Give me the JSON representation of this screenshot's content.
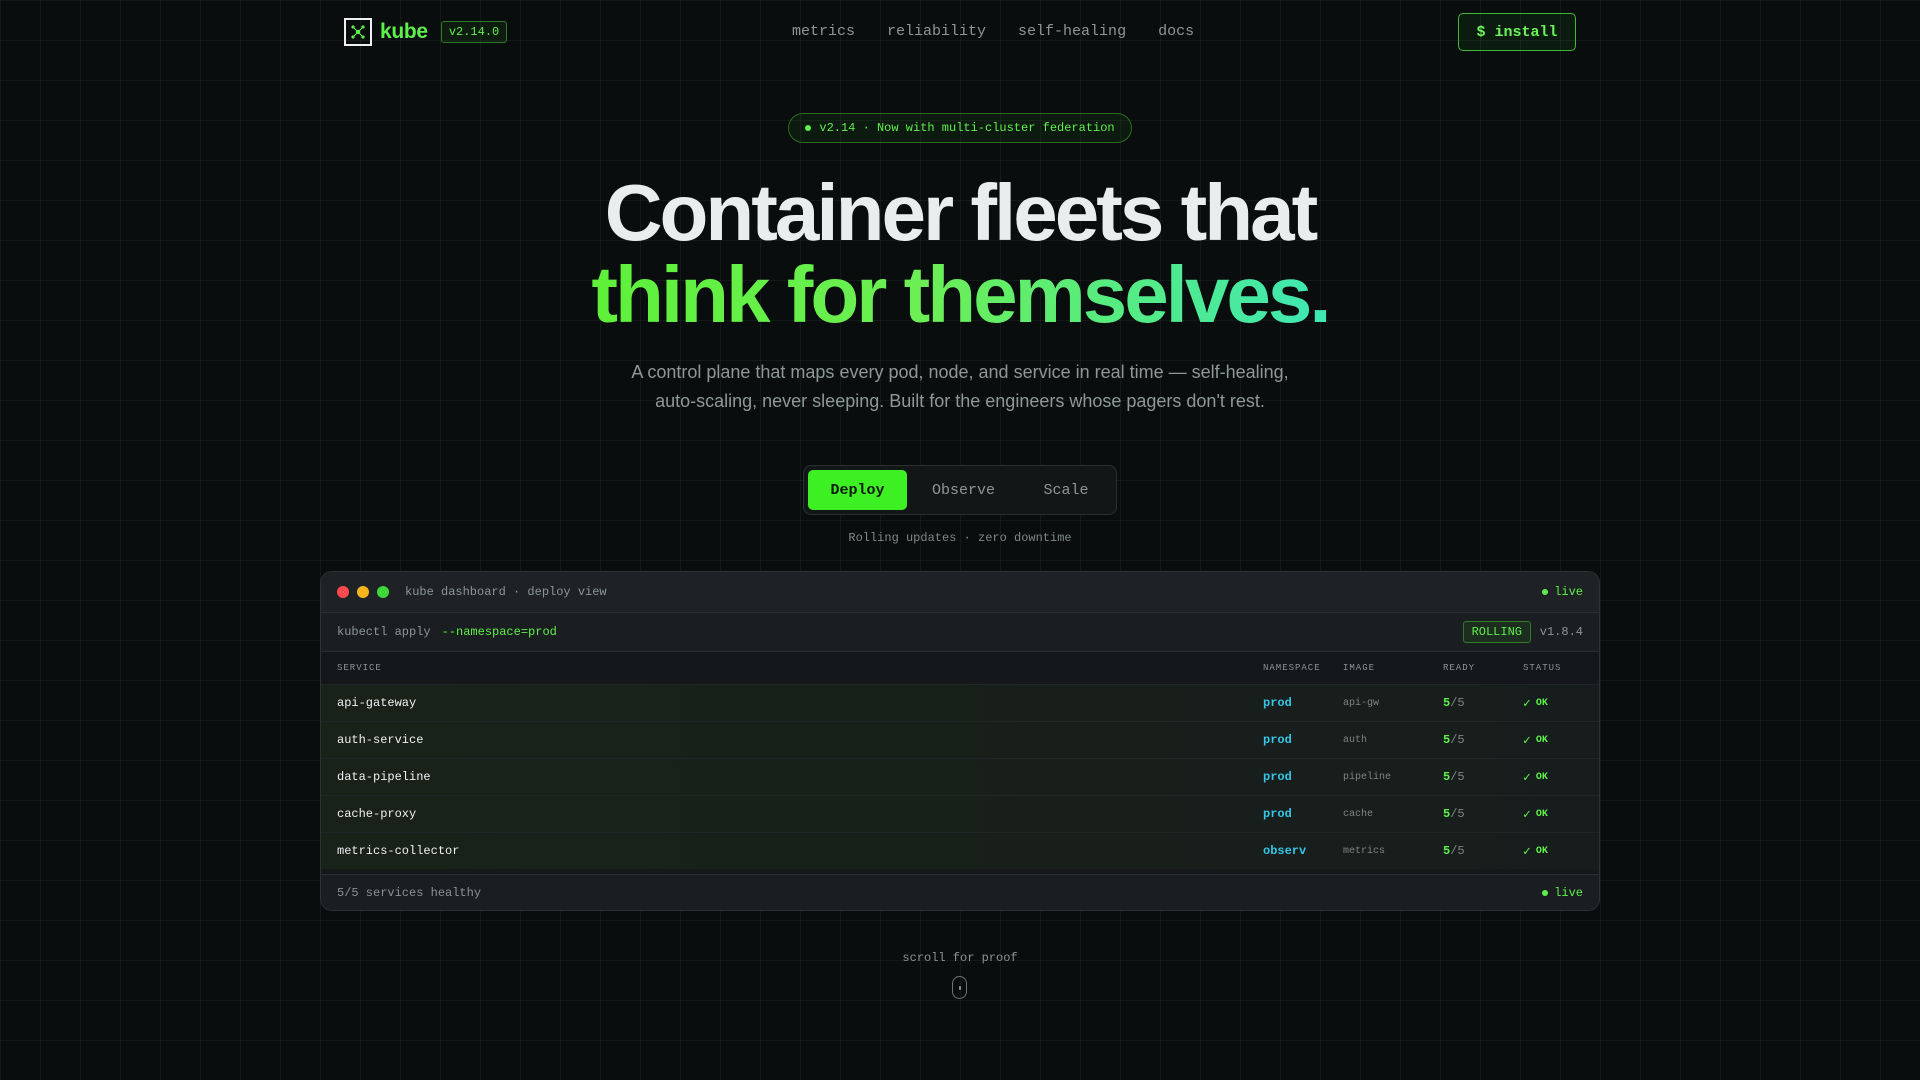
{
  "nav": {
    "brand": "kube",
    "version": "v2.14.0",
    "links": [
      "metrics",
      "reliability",
      "self-healing",
      "docs"
    ],
    "install_label": "$ install",
    "logo_icon": "network-nodes-icon"
  },
  "hero": {
    "announcement": "v2.14 · Now with multi-cluster federation",
    "headline_line1": "Container fleets that",
    "headline_line2": "think for themselves.",
    "subtitle": "A control plane that maps every pod, node, and service in real time — self-healing, auto-scaling, never sleeping. Built for the engineers whose pagers don't rest."
  },
  "tabs": {
    "items": [
      "Deploy",
      "Observe",
      "Scale"
    ],
    "active": "Deploy",
    "caption": "Rolling updates · zero downtime"
  },
  "dashboard": {
    "title": "kube dashboard · deploy view",
    "live_label": "live",
    "command": "kubectl apply",
    "command_flag": "--namespace=prod",
    "status_badge": "ROLLING",
    "release": "v1.8.4",
    "columns": [
      "SERVICE",
      "NAMESPACE",
      "IMAGE",
      "READY",
      "STATUS"
    ],
    "rows": [
      {
        "service": "api-gateway",
        "namespace": "prod",
        "image": "api-gw",
        "ready": "5",
        "total": "/5",
        "status": "OK"
      },
      {
        "service": "auth-service",
        "namespace": "prod",
        "image": "auth",
        "ready": "5",
        "total": "/5",
        "status": "OK"
      },
      {
        "service": "data-pipeline",
        "namespace": "prod",
        "image": "pipeline",
        "ready": "5",
        "total": "/5",
        "status": "OK"
      },
      {
        "service": "cache-proxy",
        "namespace": "prod",
        "image": "cache",
        "ready": "5",
        "total": "/5",
        "status": "OK"
      },
      {
        "service": "metrics-collector",
        "namespace": "observ",
        "image": "metrics",
        "ready": "5",
        "total": "/5",
        "status": "OK"
      }
    ],
    "footer_status": "5/5 services healthy",
    "footer_live": "live"
  },
  "scroll_hint": "scroll for proof",
  "colors": {
    "accent": "#5ef04a",
    "background": "#0a0d0d",
    "namespace": "#35c6e8"
  }
}
